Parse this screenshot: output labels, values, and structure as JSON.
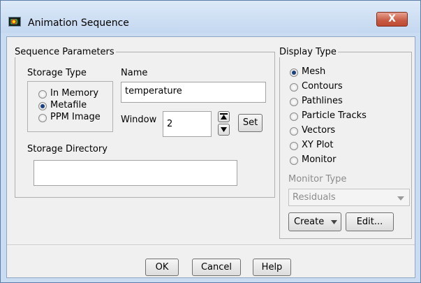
{
  "window": {
    "title": "Animation Sequence",
    "close_glyph": "X"
  },
  "sequence_parameters": {
    "group_label": "Sequence Parameters",
    "storage_type": {
      "label": "Storage Type",
      "options": [
        {
          "label": "In Memory",
          "selected": false
        },
        {
          "label": "Metafile",
          "selected": true
        },
        {
          "label": "PPM Image",
          "selected": false
        }
      ]
    },
    "name": {
      "label": "Name",
      "value": "temperature"
    },
    "window_field": {
      "label": "Window",
      "value": "2",
      "set_label": "Set"
    },
    "storage_directory": {
      "label": "Storage Directory",
      "value": ""
    }
  },
  "display_type": {
    "group_label": "Display Type",
    "options": [
      {
        "label": "Mesh",
        "selected": true
      },
      {
        "label": "Contours",
        "selected": false
      },
      {
        "label": "Pathlines",
        "selected": false
      },
      {
        "label": "Particle Tracks",
        "selected": false
      },
      {
        "label": "Vectors",
        "selected": false
      },
      {
        "label": "XY Plot",
        "selected": false
      },
      {
        "label": "Monitor",
        "selected": false
      }
    ],
    "monitor_type": {
      "label": "Monitor Type",
      "value": "Residuals"
    },
    "create_label": "Create",
    "edit_label": "Edit..."
  },
  "footer": {
    "ok_label": "OK",
    "cancel_label": "Cancel",
    "help_label": "Help"
  }
}
